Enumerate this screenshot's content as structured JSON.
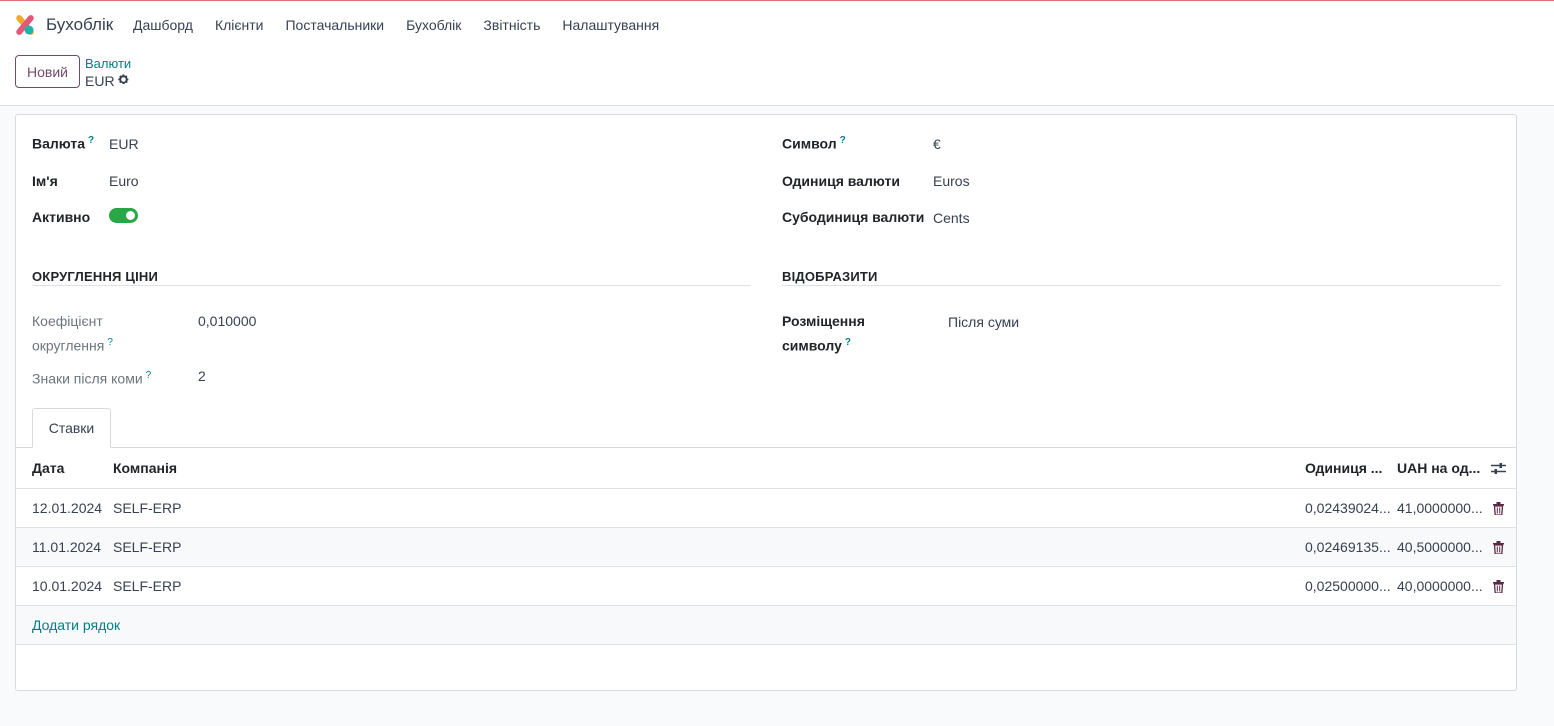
{
  "app": {
    "name": "Бухоблік",
    "nav": [
      "Дашборд",
      "Клієнти",
      "Постачальники",
      "Бухоблік",
      "Звітність",
      "Налаштування"
    ]
  },
  "control_panel": {
    "new_button": "Новий",
    "breadcrumb_parent": "Валюти",
    "breadcrumb_current": "EUR"
  },
  "form": {
    "left": {
      "currency_label": "Валюта",
      "currency_value": "EUR",
      "name_label": "Ім'я",
      "name_value": "Euro",
      "active_label": "Активно",
      "active_value": true
    },
    "right": {
      "symbol_label": "Символ",
      "symbol_value": "€",
      "unit_label": "Одиниця валюти",
      "unit_value": "Euros",
      "subunit_label": "Субодиниця валюти",
      "subunit_value": "Cents"
    },
    "rounding_section": {
      "title": "ОКРУГЛЕННЯ ЦІНИ",
      "factor_label_line1": "Коефіцієнт",
      "factor_label_line2": "округлення",
      "factor_value": "0,010000",
      "decimals_label": "Знаки після коми",
      "decimals_value": "2"
    },
    "display_section": {
      "title": "ВІДОБРАЗИТИ",
      "position_label_line1": "Розміщення",
      "position_label_line2": "символу",
      "position_value": "Після суми"
    },
    "help_mark": "?"
  },
  "tabs": [
    "Ставки"
  ],
  "rates_table": {
    "headers": {
      "date": "Дата",
      "company": "Компанія",
      "unit": "Одиниця ...",
      "uah": "UAH на од..."
    },
    "rows": [
      {
        "date": "12.01.2024",
        "company": "SELF-ERP",
        "unit": "0,02439024...",
        "uah": "41,0000000..."
      },
      {
        "date": "11.01.2024",
        "company": "SELF-ERP",
        "unit": "0,02469135...",
        "uah": "40,5000000..."
      },
      {
        "date": "10.01.2024",
        "company": "SELF-ERP",
        "unit": "0,02500000...",
        "uah": "40,0000000..."
      }
    ],
    "add_row": "Додати рядок"
  },
  "colors": {
    "brand": "#714b67",
    "link": "#017e84",
    "toggle_on": "#28a745"
  }
}
